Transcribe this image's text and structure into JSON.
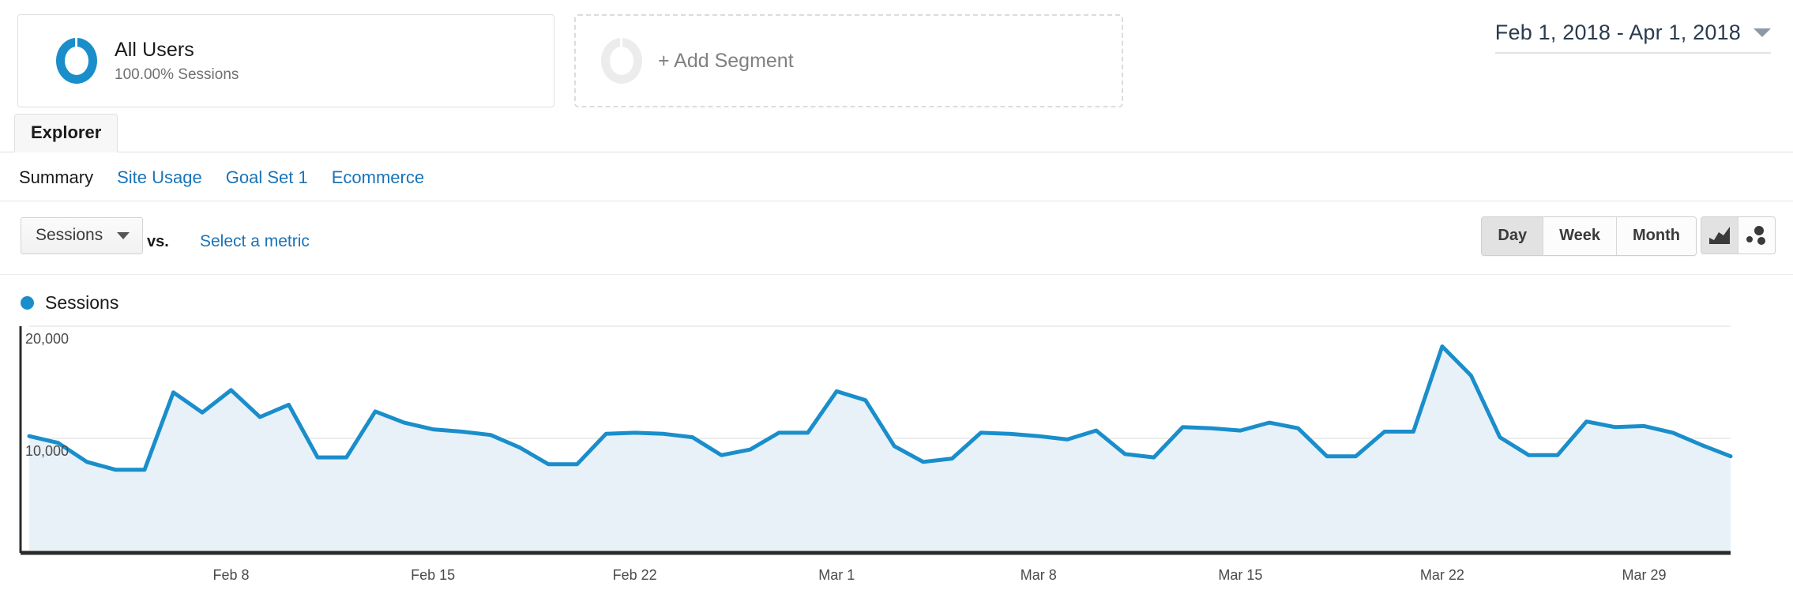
{
  "segment": {
    "icon": "donut-icon",
    "title": "All Users",
    "subtitle": "100.00% Sessions"
  },
  "add_segment": {
    "icon": "donut-outline-icon",
    "label": "+ Add Segment"
  },
  "date_range": {
    "label": "Feb 1, 2018 - Apr 1, 2018",
    "caret": "chevron-down-icon"
  },
  "tabs": {
    "active": "Explorer",
    "explorer_label": "Explorer"
  },
  "subtabs": [
    {
      "label": "Summary",
      "active": true
    },
    {
      "label": "Site Usage",
      "active": false
    },
    {
      "label": "Goal Set 1",
      "active": false
    },
    {
      "label": "Ecommerce",
      "active": false
    }
  ],
  "controls": {
    "metric_selected": "Sessions",
    "vs_label": "vs.",
    "select_metric_label": "Select a metric",
    "granularity": [
      {
        "label": "Day",
        "active": true
      },
      {
        "label": "Week",
        "active": false
      },
      {
        "label": "Month",
        "active": false
      }
    ],
    "chart_types": [
      {
        "name": "area-chart-icon",
        "active": true
      },
      {
        "name": "motion-chart-icon",
        "active": false
      }
    ]
  },
  "legend": {
    "series_label": "Sessions",
    "color": "#1a8ecb"
  },
  "colors": {
    "line": "#1a8ecb",
    "fill": "#e8f1f8",
    "link": "#1a73b7",
    "axis": "#2b2b2b",
    "grid": "#ededed"
  },
  "chart_data": {
    "type": "area",
    "title": "Sessions",
    "xlabel": "",
    "ylabel": "Sessions",
    "ylim": [
      0,
      20000
    ],
    "grid": true,
    "legend_position": "top-left",
    "y_ticks": [
      {
        "value": 10000,
        "label": "10,000"
      },
      {
        "value": 20000,
        "label": "20,000"
      }
    ],
    "x_ticks": [
      "Feb 8",
      "Feb 15",
      "Feb 22",
      "Mar 1",
      "Mar 8",
      "Mar 15",
      "Mar 22",
      "Mar 29"
    ],
    "x_tick_indices": [
      7,
      14,
      21,
      28,
      35,
      42,
      49,
      56
    ],
    "x": [
      "Feb 1",
      "Feb 2",
      "Feb 3",
      "Feb 4",
      "Feb 5",
      "Feb 6",
      "Feb 7",
      "Feb 8",
      "Feb 9",
      "Feb 10",
      "Feb 11",
      "Feb 12",
      "Feb 13",
      "Feb 14",
      "Feb 15",
      "Feb 16",
      "Feb 17",
      "Feb 18",
      "Feb 19",
      "Feb 20",
      "Feb 21",
      "Feb 22",
      "Feb 23",
      "Feb 24",
      "Feb 25",
      "Feb 26",
      "Feb 27",
      "Feb 28",
      "Mar 1",
      "Mar 2",
      "Mar 3",
      "Mar 4",
      "Mar 5",
      "Mar 6",
      "Mar 7",
      "Mar 8",
      "Mar 9",
      "Mar 10",
      "Mar 11",
      "Mar 12",
      "Mar 13",
      "Mar 14",
      "Mar 15",
      "Mar 16",
      "Mar 17",
      "Mar 18",
      "Mar 19",
      "Mar 20",
      "Mar 21",
      "Mar 22",
      "Mar 23",
      "Mar 24",
      "Mar 25",
      "Mar 26",
      "Mar 27",
      "Mar 28",
      "Mar 29",
      "Mar 30",
      "Mar 31",
      "Apr 1"
    ],
    "series": [
      {
        "name": "Sessions",
        "color": "#1a8ecb",
        "values": [
          10200,
          9600,
          7900,
          7200,
          7200,
          14100,
          12300,
          14300,
          11900,
          13000,
          8300,
          8300,
          12400,
          11400,
          10800,
          10600,
          10300,
          9200,
          7700,
          7700,
          10400,
          10500,
          10400,
          10100,
          8500,
          9000,
          10500,
          10500,
          14200,
          13400,
          9300,
          7900,
          8200,
          10500,
          10400,
          10200,
          9900,
          10700,
          8600,
          8300,
          11000,
          10900,
          10700,
          11400,
          10900,
          8400,
          8400,
          10600,
          10600,
          18200,
          15600,
          10100,
          8500,
          8500,
          11500,
          11000,
          11100,
          10500,
          9400,
          8400
        ]
      }
    ]
  }
}
